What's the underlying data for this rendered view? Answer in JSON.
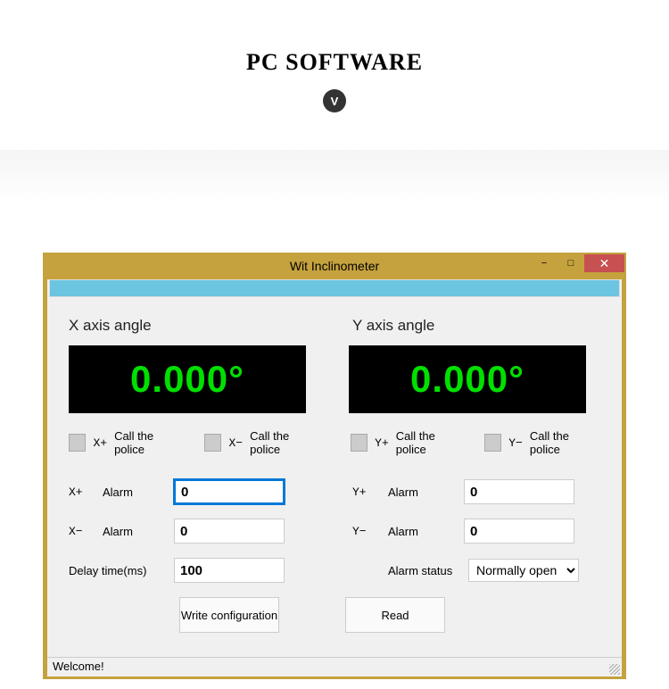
{
  "page": {
    "heading": "PC SOFTWARE",
    "badge": "V"
  },
  "window": {
    "title": "Wit Inclinometer",
    "controls": {
      "min": "−",
      "max": "□",
      "close": "✕"
    },
    "xaxis": {
      "label": "X axis angle",
      "value": "0.000°",
      "police_plus": {
        "symbol": "X+",
        "label": "Call the police"
      },
      "police_minus": {
        "symbol": "X−",
        "label": "Call the police"
      },
      "alarm_plus": {
        "symbol": "X+",
        "label": "Alarm",
        "value": "0"
      },
      "alarm_minus": {
        "symbol": "X−",
        "label": "Alarm",
        "value": "0"
      },
      "delay": {
        "label": "Delay time(ms)",
        "value": "100"
      }
    },
    "yaxis": {
      "label": "Y axis angle",
      "value": "0.000°",
      "police_plus": {
        "symbol": "Y+",
        "label": "Call the police"
      },
      "police_minus": {
        "symbol": "Y−",
        "label": "Call the police"
      },
      "alarm_plus": {
        "symbol": "Y+",
        "label": "Alarm",
        "value": "0"
      },
      "alarm_minus": {
        "symbol": "Y−",
        "label": "Alarm",
        "value": "0"
      },
      "alarm_status": {
        "label": "Alarm status",
        "value": "Normally open"
      }
    },
    "buttons": {
      "write": "Write configuration",
      "read": "Read"
    },
    "status": "Welcome!"
  }
}
